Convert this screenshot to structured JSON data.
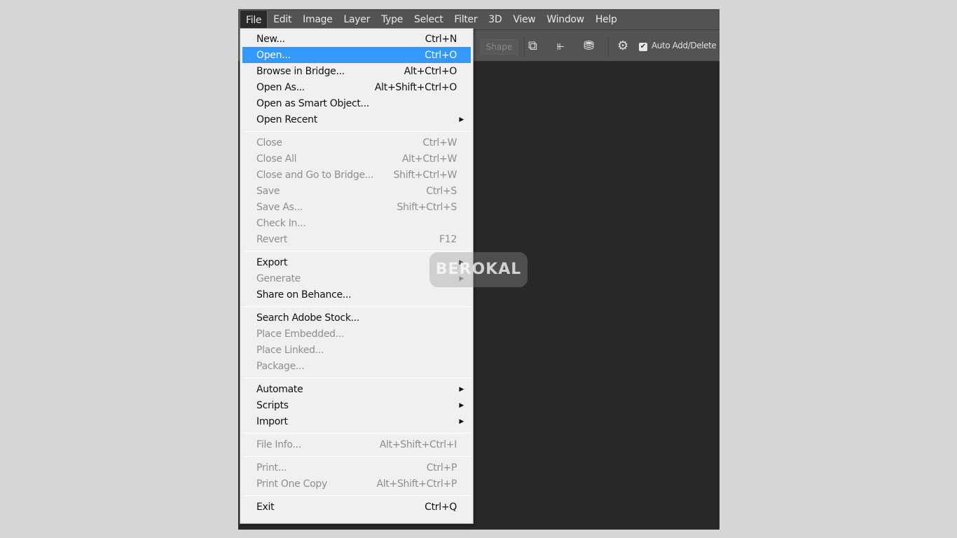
{
  "menubar": [
    "File",
    "Edit",
    "Image",
    "Layer",
    "Type",
    "Select",
    "Filter",
    "3D",
    "View",
    "Window",
    "Help"
  ],
  "toolbar": {
    "shape_label": "Shape",
    "auto_add_delete": "Auto Add/Delete",
    "auto_add_delete_checked": true,
    "icons": [
      "path-operations-icon",
      "path-alignment-icon",
      "path-arrangement-icon",
      "gear-icon"
    ]
  },
  "file_menu": [
    {
      "label": "New...",
      "shortcut": "Ctrl+N"
    },
    {
      "label": "Open...",
      "shortcut": "Ctrl+O",
      "highlighted": true
    },
    {
      "label": "Browse in Bridge...",
      "shortcut": "Alt+Ctrl+O"
    },
    {
      "label": "Open As...",
      "shortcut": "Alt+Shift+Ctrl+O"
    },
    {
      "label": "Open as Smart Object...",
      "shortcut": ""
    },
    {
      "label": "Open Recent",
      "shortcut": "",
      "submenu": true
    },
    {
      "separator": true
    },
    {
      "label": "Close",
      "shortcut": "Ctrl+W",
      "disabled": true
    },
    {
      "label": "Close All",
      "shortcut": "Alt+Ctrl+W",
      "disabled": true
    },
    {
      "label": "Close and Go to Bridge...",
      "shortcut": "Shift+Ctrl+W",
      "disabled": true
    },
    {
      "label": "Save",
      "shortcut": "Ctrl+S",
      "disabled": true
    },
    {
      "label": "Save As...",
      "shortcut": "Shift+Ctrl+S",
      "disabled": true
    },
    {
      "label": "Check In...",
      "shortcut": "",
      "disabled": true
    },
    {
      "label": "Revert",
      "shortcut": "F12",
      "disabled": true
    },
    {
      "separator": true
    },
    {
      "label": "Export",
      "shortcut": "",
      "submenu": true
    },
    {
      "label": "Generate",
      "shortcut": "",
      "submenu": true,
      "disabled": true
    },
    {
      "label": "Share on Behance...",
      "shortcut": ""
    },
    {
      "separator": true
    },
    {
      "label": "Search Adobe Stock...",
      "shortcut": ""
    },
    {
      "label": "Place Embedded...",
      "shortcut": "",
      "disabled": true
    },
    {
      "label": "Place Linked...",
      "shortcut": "",
      "disabled": true
    },
    {
      "label": "Package...",
      "shortcut": "",
      "disabled": true
    },
    {
      "separator": true
    },
    {
      "label": "Automate",
      "shortcut": "",
      "submenu": true
    },
    {
      "label": "Scripts",
      "shortcut": "",
      "submenu": true
    },
    {
      "label": "Import",
      "shortcut": "",
      "submenu": true
    },
    {
      "separator": true
    },
    {
      "label": "File Info...",
      "shortcut": "Alt+Shift+Ctrl+I",
      "disabled": true
    },
    {
      "separator": true
    },
    {
      "label": "Print...",
      "shortcut": "Ctrl+P",
      "disabled": true
    },
    {
      "label": "Print One Copy",
      "shortcut": "Alt+Shift+Ctrl+P",
      "disabled": true
    },
    {
      "separator": true
    },
    {
      "label": "Exit",
      "shortcut": "Ctrl+Q"
    }
  ],
  "watermark": "BEROKAL",
  "colors": {
    "highlight": "#3399ff",
    "menu_bg": "#f0f0f0",
    "app_bg": "#535353",
    "canvas": "#282828"
  }
}
